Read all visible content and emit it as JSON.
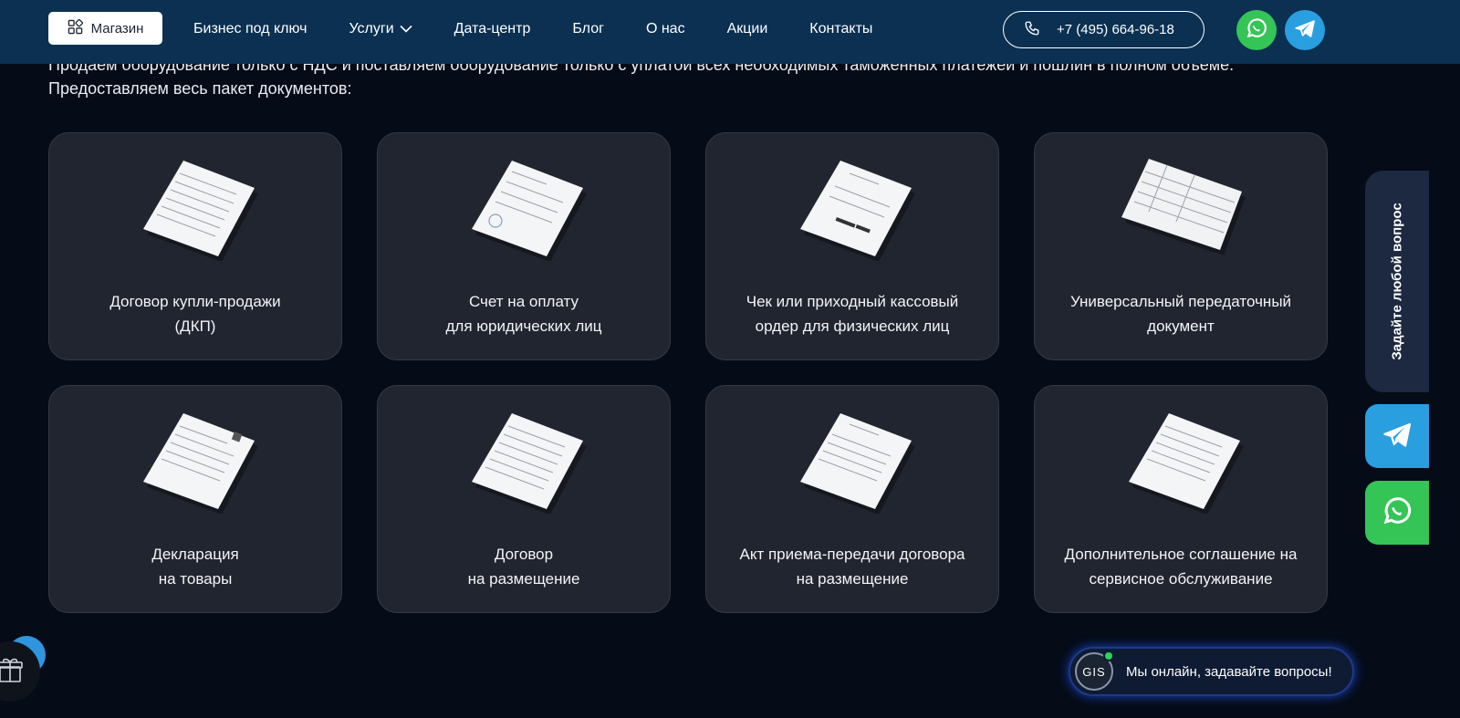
{
  "intro": {
    "text": "Продаем оборудование только с НДС и поставляем оборудование только с уплатой всех необходимых таможенных платежей и пошлин в полном объеме. Предоставляем весь пакет документов:"
  },
  "header": {
    "shop_label": "Магазин",
    "nav": [
      {
        "label": "Бизнес под ключ"
      },
      {
        "label": "Услуги"
      },
      {
        "label": "Дата-центр"
      },
      {
        "label": "Блог"
      },
      {
        "label": "О нас"
      },
      {
        "label": "Акции"
      },
      {
        "label": "Контакты"
      }
    ],
    "phone": "+7 (495) 664-96-18"
  },
  "documents": [
    {
      "line1": "Договор купли-продажи",
      "line2": "(ДКП)"
    },
    {
      "line1": "Счет на оплату",
      "line2": "для юридических лиц"
    },
    {
      "line1": "Чек или приходный кассовый",
      "line2": "ордер для физических лиц"
    },
    {
      "line1": "Универсальный передаточный",
      "line2": "документ"
    },
    {
      "line1": "Декларация",
      "line2": "на товары"
    },
    {
      "line1": "Договор",
      "line2": "на размещение"
    },
    {
      "line1": "Акт приема-передачи договора",
      "line2": "на размещение"
    },
    {
      "line1": "Дополнительное соглашение на",
      "line2": "сервисное обслуживание"
    }
  ],
  "side": {
    "question_label": "Задайте любой вопрос"
  },
  "chat": {
    "avatar_text": "GIS",
    "message": "Мы онлайн, задавайте вопросы!"
  },
  "colors": {
    "header_bg": "#0b3052",
    "page_bg": "#050b17",
    "card_bg": "#21252f",
    "whatsapp": "#35c456",
    "telegram": "#2a9fe0"
  }
}
